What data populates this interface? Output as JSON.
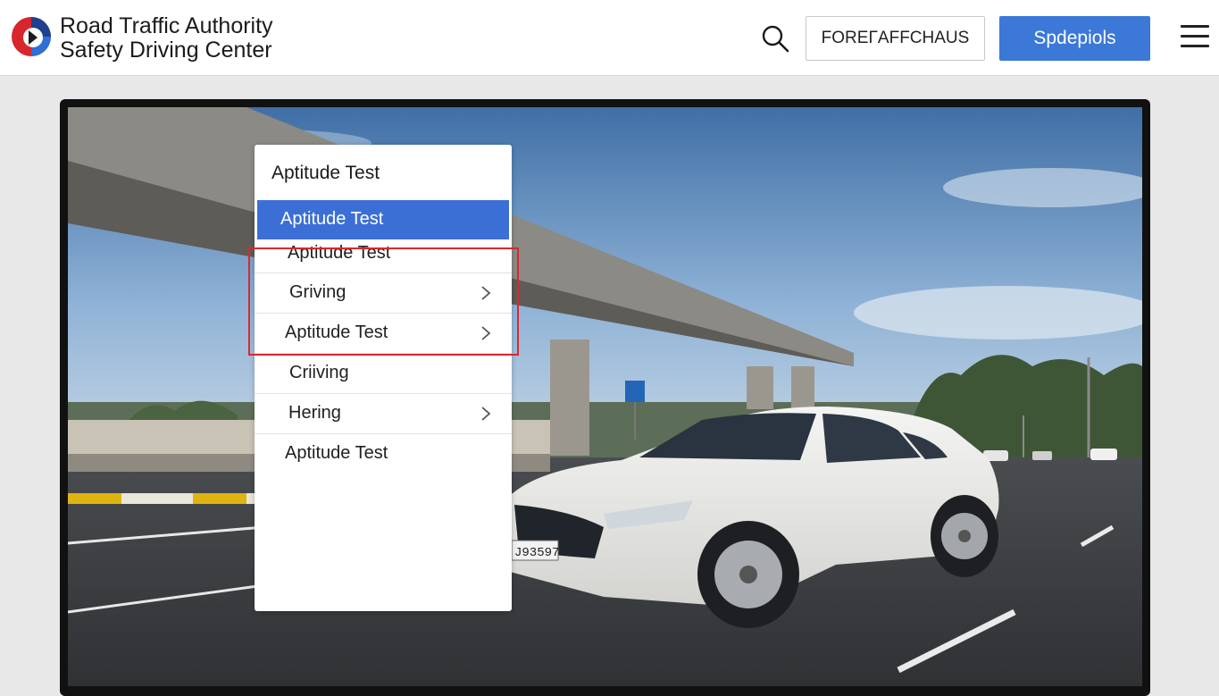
{
  "header": {
    "title_line1": "Road Traffic Authority",
    "title_line2": "Safety Driving Center",
    "search_icon": "search-icon",
    "outline_button_label": "FOREΓAFFCHAUS",
    "primary_button_label": "Spdepiols",
    "menu_icon": "hamburger-menu-icon"
  },
  "colors": {
    "primary": "#3c78d8",
    "highlight": "#d9282f",
    "menu_active": "#3c6fd6"
  },
  "dropdown": {
    "title": "Aptitude Test",
    "items": [
      {
        "label": "Aptitude Test",
        "active": true,
        "chevron": false
      },
      {
        "label": "Aptitude Test",
        "active": false,
        "chevron": false
      },
      {
        "label": "Griving",
        "active": false,
        "chevron": true
      },
      {
        "label": "Aptitude Test",
        "active": false,
        "chevron": true
      },
      {
        "label": "Criiving",
        "active": false,
        "chevron": false
      },
      {
        "label": "Hering",
        "active": false,
        "chevron": true
      },
      {
        "label": "Aptitude Test",
        "active": false,
        "chevron": false
      }
    ]
  },
  "photo": {
    "license_plate": "J93597"
  }
}
